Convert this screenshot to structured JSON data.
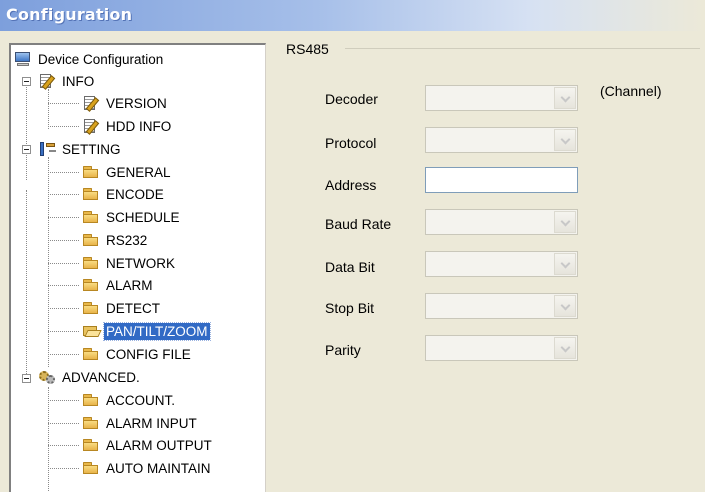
{
  "window": {
    "title": "Configuration"
  },
  "tree": {
    "root": {
      "label": "Device Configuration",
      "icon": "computer-icon"
    },
    "info": {
      "label": "INFO",
      "icon": "doc-edit-icon",
      "children": [
        "VERSION",
        "HDD INFO"
      ]
    },
    "setting": {
      "label": "SETTING",
      "icon": "tools-icon",
      "children": [
        "GENERAL",
        "ENCODE",
        "SCHEDULE",
        "RS232",
        "NETWORK",
        "ALARM",
        "DETECT",
        "PAN/TILT/ZOOM",
        "CONFIG FILE"
      ],
      "selected": "PAN/TILT/ZOOM"
    },
    "advanced": {
      "label": "ADVANCED.",
      "icon": "gears-icon",
      "children": [
        "ACCOUNT.",
        "ALARM INPUT",
        "ALARM OUTPUT",
        "AUTO MAINTAIN"
      ]
    }
  },
  "panel": {
    "group_label": "RS485",
    "fields": {
      "decoder": {
        "label": "Decoder",
        "value": ""
      },
      "protocol": {
        "label": "Protocol",
        "value": ""
      },
      "address": {
        "label": "Address",
        "value": ""
      },
      "baud_rate": {
        "label": "Baud Rate",
        "value": ""
      },
      "data_bit": {
        "label": "Data Bit",
        "value": ""
      },
      "stop_bit": {
        "label": "Stop Bit",
        "value": ""
      },
      "parity": {
        "label": "Parity",
        "value": ""
      }
    },
    "channel_label": "(Channel)"
  }
}
